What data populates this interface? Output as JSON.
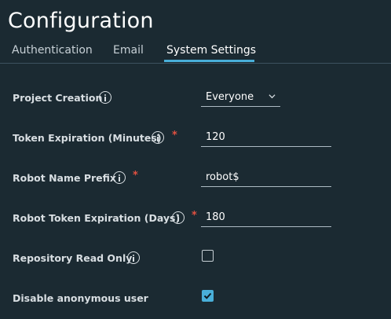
{
  "page": {
    "title": "Configuration"
  },
  "tabs": [
    {
      "label": "Authentication",
      "active": false
    },
    {
      "label": "Email",
      "active": false
    },
    {
      "label": "System Settings",
      "active": true
    }
  ],
  "settings": {
    "project_creation": {
      "label": "Project Creation",
      "value": "Everyone",
      "info_icon": "info-icon"
    },
    "token_expiration": {
      "label": "Token Expiration (Minutes)",
      "value": "120",
      "required_mark": "*",
      "info_icon": "info-icon"
    },
    "robot_name_prefix": {
      "label": "Robot Name Prefix",
      "value": "robot$",
      "required_mark": "*",
      "info_icon": "info-icon"
    },
    "robot_token_expiration": {
      "label": "Robot Token Expiration (Days)",
      "value": "180",
      "required_mark": "*",
      "info_icon": "info-icon"
    },
    "repository_read_only": {
      "label": "Repository Read Only",
      "checked": false,
      "info_icon": "info-icon"
    },
    "disable_anonymous_user": {
      "label": "Disable anonymous user",
      "checked": true
    }
  },
  "colors": {
    "background": "#1b2a32",
    "accent": "#49afd9",
    "required": "#e25141"
  }
}
